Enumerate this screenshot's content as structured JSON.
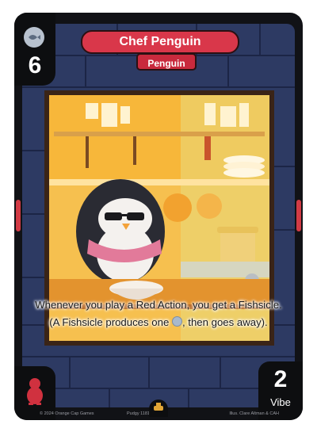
{
  "card": {
    "name": "Chef Penguin",
    "type": "Penguin",
    "cost": "6",
    "cost_icon": "fish-token-icon",
    "power": "2",
    "power_label": "Vibe",
    "faction_icon": "penguin-silhouette-icon",
    "faction_color": "#d0313f",
    "set_icon": "pudgy-boat-set-icon",
    "ability": {
      "line1": "Whenever you play a Red Action, you get a Fishsicle.",
      "line2_before": "(A Fishsicle produces one",
      "line2_icon": "fish-token-icon",
      "line2_after": ", then goes away)."
    }
  },
  "footer": {
    "copyright": "© 2024 Orange Cap Games",
    "collector": "Pudgy 1181 · 4/200",
    "illustrator": "Illus. Clare Altman & CAH"
  },
  "colors": {
    "banner_red": "#d9374a",
    "frame_black": "#111216",
    "accent_red": "#d23b45"
  }
}
